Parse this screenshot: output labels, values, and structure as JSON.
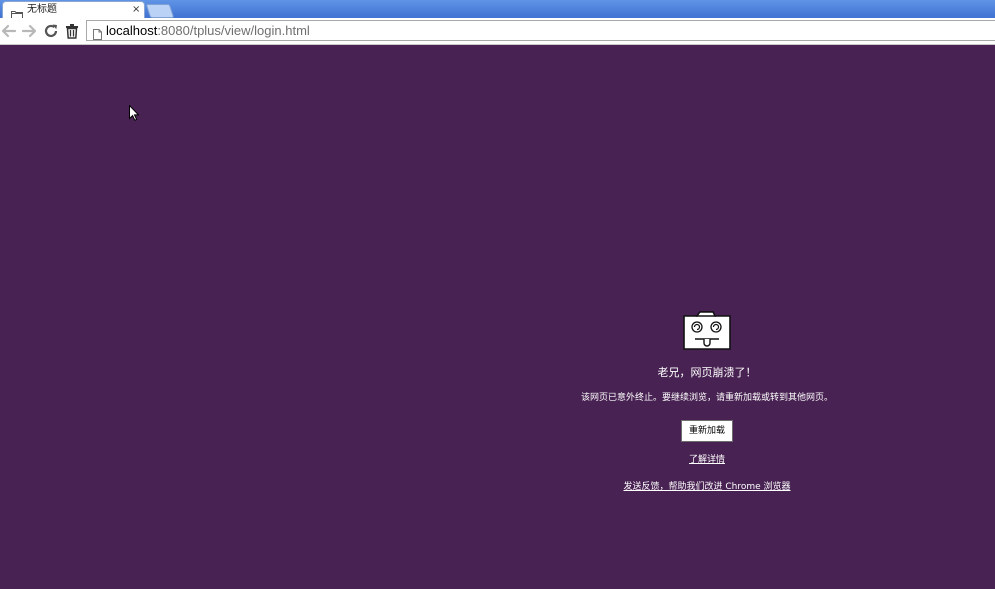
{
  "tab": {
    "title": "无标题",
    "close_glyph": "×",
    "icon": "folder-icon"
  },
  "toolbar": {
    "url_host": "localhost",
    "url_rest": ":8080/tplus/view/login.html"
  },
  "crash": {
    "icon": "dead-folder-face-icon",
    "heading": "老兄，网页崩溃了！",
    "description": "该网页已意外终止。要继续浏览，请重新加载或转到其他网页。",
    "reload_label": "重新加载",
    "learn_more": "了解详情",
    "feedback": "发送反馈，帮助我们改进 Chrome 浏览器"
  },
  "colors": {
    "page_background": "#482252",
    "tabstrip": "#4a7fdc",
    "text": "#ffffff"
  }
}
